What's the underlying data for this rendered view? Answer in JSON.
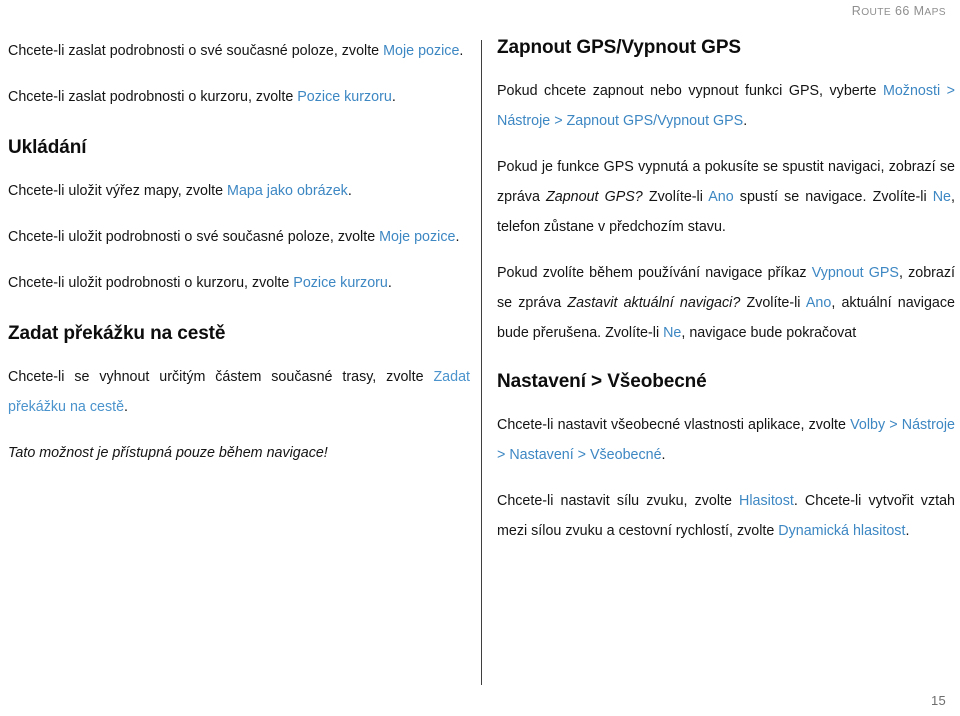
{
  "header": {
    "title_lead": "R",
    "title_rest": "OUTE",
    "title_number": " 66 ",
    "title_maps_lead": "M",
    "title_maps_rest": "APS",
    "full_title": "ROUTE 66 MAPS"
  },
  "footer": {
    "page_number": "15"
  },
  "colors": {
    "link": "#3d87c3",
    "link_light": "#4a93cc",
    "text": "#141414",
    "heading": "#0d0d0d",
    "divider": "#3f3f3f",
    "header_text": "#8f8f8f",
    "page_number": "#6d6d6d"
  },
  "left_column": {
    "blocks": [
      {
        "type": "paragraph",
        "id": "send-current-position",
        "runs": [
          {
            "text": "Chcete-li zaslat podrobnosti o své současné poloze, zvolte ",
            "style": "normal"
          },
          {
            "text": "Moje pozice",
            "style": "link"
          },
          {
            "text": ".",
            "style": "normal"
          }
        ],
        "plain": "Chcete-li zaslat podrobnosti o své současné poloze, zvolte Moje pozice."
      },
      {
        "type": "paragraph",
        "id": "send-cursor-position",
        "runs": [
          {
            "text": "Chcete-li zaslat podrobnosti o kurzoru, zvolte ",
            "style": "normal"
          },
          {
            "text": "Pozice kurzoru",
            "style": "link"
          },
          {
            "text": ".",
            "style": "normal"
          }
        ],
        "plain": "Chcete-li zaslat podrobnosti o kurzoru, zvolte Pozice kurzoru."
      },
      {
        "type": "heading",
        "id": "ukladani",
        "text": "Ukládání"
      },
      {
        "type": "paragraph",
        "id": "save-map-image",
        "runs": [
          {
            "text": "Chcete-li uložit výřez mapy, zvolte ",
            "style": "normal"
          },
          {
            "text": "Mapa jako obrázek",
            "style": "link"
          },
          {
            "text": ".",
            "style": "normal"
          }
        ],
        "plain": "Chcete-li uložit výřez mapy, zvolte Mapa jako obrázek."
      },
      {
        "type": "paragraph",
        "id": "save-current-position",
        "runs": [
          {
            "text": "Chcete-li uložit podrobnosti o své současné poloze, zvolte ",
            "style": "normal"
          },
          {
            "text": "Moje pozice",
            "style": "link"
          },
          {
            "text": ".",
            "style": "normal"
          }
        ],
        "plain": "Chcete-li uložit podrobnosti o své současné poloze, zvolte Moje pozice."
      },
      {
        "type": "paragraph",
        "id": "save-cursor-position",
        "runs": [
          {
            "text": "Chcete-li uložit podrobnosti o kurzoru, zvolte ",
            "style": "normal"
          },
          {
            "text": "Pozice kurzoru",
            "style": "link"
          },
          {
            "text": ".",
            "style": "normal"
          }
        ],
        "plain": "Chcete-li uložit podrobnosti o kurzoru, zvolte Pozice kurzoru."
      },
      {
        "type": "heading",
        "id": "zadat-prekazku",
        "text": "Zadat překážku na cestě"
      },
      {
        "type": "paragraph",
        "id": "avoid-route-parts",
        "runs": [
          {
            "text": "Chcete-li se vyhnout určitým částem současné trasy, zvolte ",
            "style": "normal"
          },
          {
            "text": "Zadat překážku na cestě",
            "style": "link-light"
          },
          {
            "text": ".",
            "style": "normal"
          }
        ],
        "plain": "Chcete-li se vyhnout určitým částem současné trasy, zvolte Zadat překážku na cestě."
      },
      {
        "type": "paragraph-italic",
        "id": "navigation-only-note",
        "text": "Tato možnost je přístupná pouze během navigace!"
      }
    ]
  },
  "right_column": {
    "blocks": [
      {
        "type": "heading",
        "id": "gps-on-off",
        "text": "Zapnout GPS/Vypnout GPS"
      },
      {
        "type": "paragraph",
        "id": "gps-menu-path",
        "runs": [
          {
            "text": "Pokud chcete zapnout nebo vypnout funkci GPS, vyberte ",
            "style": "normal"
          },
          {
            "text": "Možnosti > Nástroje > Zapnout GPS/Vypnout GPS",
            "style": "link"
          },
          {
            "text": ".",
            "style": "normal"
          }
        ],
        "plain": "Pokud chcete zapnout nebo vypnout funkci GPS, vyberte Možnosti > Nástroje > Zapnout GPS/Vypnout GPS."
      },
      {
        "type": "paragraph",
        "id": "gps-off-start-navigation",
        "runs": [
          {
            "text": "Pokud je funkce GPS vypnutá a pokusíte se spustit navigaci, zobrazí se zpráva ",
            "style": "normal"
          },
          {
            "text": "Zapnout GPS?",
            "style": "italic"
          },
          {
            "text": " Zvolíte-li ",
            "style": "normal"
          },
          {
            "text": "Ano",
            "style": "link"
          },
          {
            "text": " spustí se navigace. Zvolíte-li ",
            "style": "normal"
          },
          {
            "text": "Ne",
            "style": "link"
          },
          {
            "text": ", telefon zůstane v předchozím stavu.",
            "style": "normal"
          }
        ],
        "plain": "Pokud je funkce GPS vypnutá a pokusíte se spustit navigaci, zobrazí se zpráva Zapnout GPS? Zvolíte-li Ano spustí se navigace. Zvolíte-li Ne, telefon zůstane v předchozím stavu."
      },
      {
        "type": "paragraph",
        "id": "gps-off-during-navigation",
        "runs": [
          {
            "text": "Pokud zvolíte během používání navigace příkaz ",
            "style": "normal"
          },
          {
            "text": "Vypnout GPS",
            "style": "link"
          },
          {
            "text": ", zobrazí se zpráva ",
            "style": "normal"
          },
          {
            "text": "Zastavit aktuální navigaci?",
            "style": "italic"
          },
          {
            "text": " Zvolíte-li ",
            "style": "normal"
          },
          {
            "text": "Ano",
            "style": "link"
          },
          {
            "text": ", aktuální navigace bude přerušena. Zvolíte-li ",
            "style": "normal"
          },
          {
            "text": "Ne",
            "style": "link"
          },
          {
            "text": ", navigace bude pokračovat",
            "style": "normal"
          }
        ],
        "plain": "Pokud zvolíte během používání navigace příkaz Vypnout GPS, zobrazí se zpráva Zastavit aktuální navigaci? Zvolíte-li Ano, aktuální navigace bude přerušena. Zvolíte-li Ne, navigace bude pokračovat"
      },
      {
        "type": "heading",
        "id": "nastaveni-vseobecne",
        "text": "Nastavení > Všeobecné"
      },
      {
        "type": "paragraph",
        "id": "general-settings-path",
        "runs": [
          {
            "text": "Chcete-li nastavit všeobecné vlastnosti aplikace, zvolte ",
            "style": "normal"
          },
          {
            "text": "Volby > Nástroje > Nastavení > Všeobecné",
            "style": "link"
          },
          {
            "text": ".",
            "style": "normal"
          }
        ],
        "plain": "Chcete-li nastavit všeobecné vlastnosti aplikace, zvolte Volby > Nástroje > Nastavení > Všeobecné."
      },
      {
        "type": "paragraph",
        "id": "volume-settings",
        "runs": [
          {
            "text": "Chcete-li nastavit sílu zvuku, zvolte ",
            "style": "normal"
          },
          {
            "text": "Hlasitost",
            "style": "link"
          },
          {
            "text": ". Chcete-li vytvořit vztah mezi sílou zvuku a cestovní rychlostí, zvolte ",
            "style": "normal"
          },
          {
            "text": "Dynamická hlasitost",
            "style": "link"
          },
          {
            "text": ".",
            "style": "normal"
          }
        ],
        "plain": "Chcete-li nastavit sílu zvuku, zvolte Hlasitost. Chcete-li vytvořit vztah mezi sílou zvuku a cestovní rychlostí, zvolte Dynamická hlasitost."
      }
    ]
  }
}
